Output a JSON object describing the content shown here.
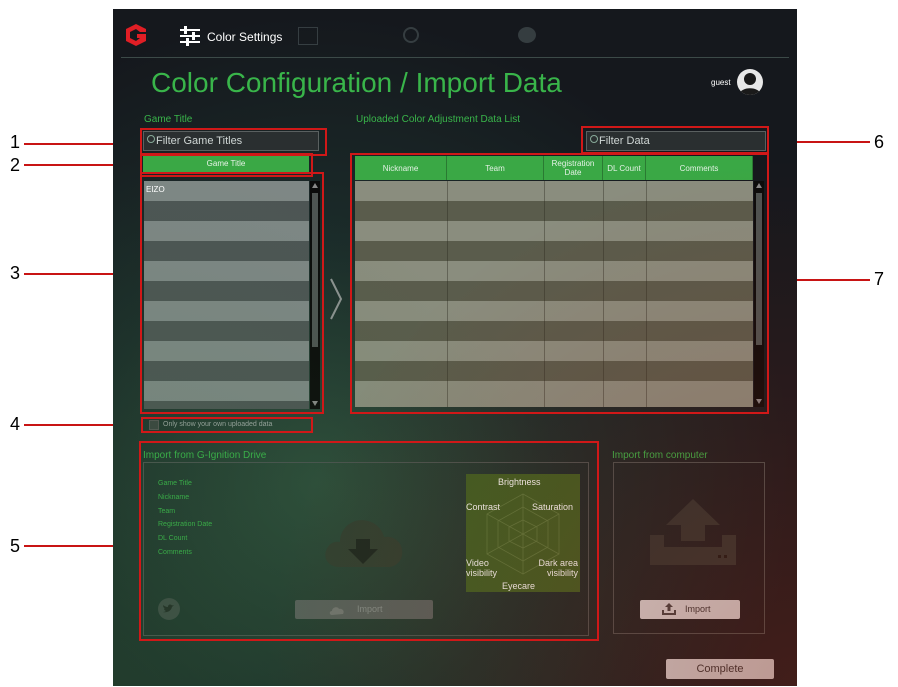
{
  "callouts": [
    "1",
    "2",
    "3",
    "4",
    "5",
    "6",
    "7"
  ],
  "header": {
    "tab_label": "Color Settings",
    "ghost_tabs": [
      "",
      "",
      ""
    ]
  },
  "page_title": "Color Configuration / Import Data",
  "user": {
    "name": "guest"
  },
  "game_title_section": {
    "label": "Game Title",
    "filter_placeholder": "Filter Game Titles",
    "column_header": "Game Title",
    "items": [
      "EIZO",
      "",
      "",
      "",
      "",
      "",
      "",
      "",
      "",
      "",
      "",
      ""
    ]
  },
  "uploaded_section": {
    "label": "Uploaded Color Adjustment Data List",
    "filter_placeholder": "Filter Data",
    "columns": [
      "Nickname",
      "Team",
      "Registration Date",
      "DL Count",
      "Comments"
    ],
    "rows": 11
  },
  "own_data_checkbox": {
    "label": "Only show your own uploaded data",
    "checked": false
  },
  "import_drive": {
    "label": "Import from G-Ignition Drive",
    "meta_labels": [
      "Game Title",
      "Nickname",
      "Team",
      "Registration Date",
      "DL Count",
      "Comments"
    ],
    "button_label": "Import",
    "radar_labels": {
      "top": "Brightness",
      "left": "Contrast",
      "right": "Saturation",
      "bottom_left": "Video visibility",
      "bottom_right": "Dark area visibility",
      "bottom": "Eyecare"
    }
  },
  "import_computer": {
    "label": "Import from computer",
    "button_label": "Import"
  },
  "complete_button": "Complete",
  "colors": {
    "accent_green": "#39b54a",
    "callout_red": "#d01818"
  }
}
